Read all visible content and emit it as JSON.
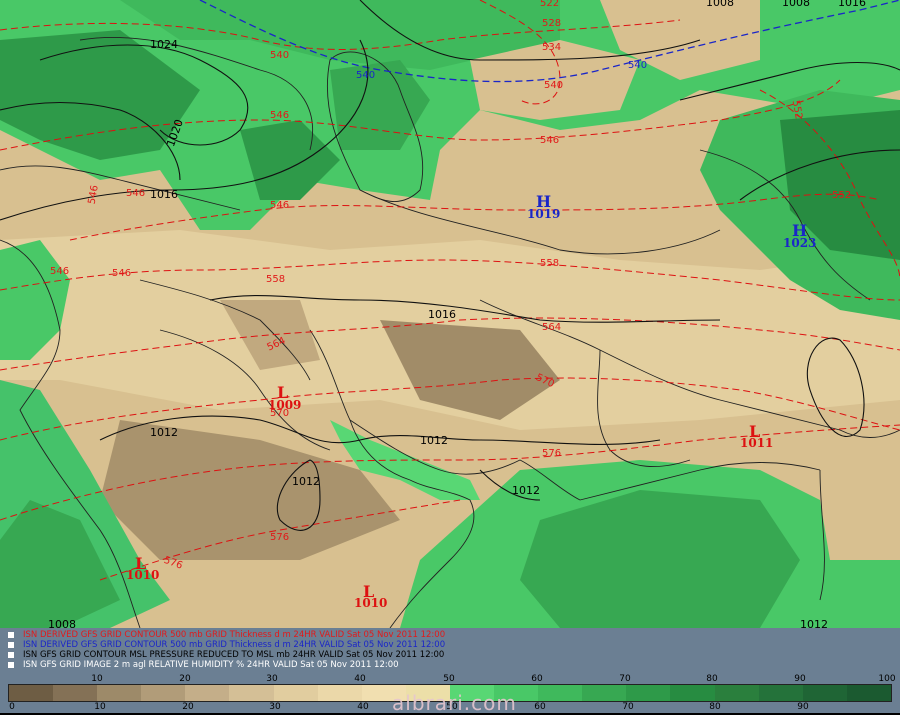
{
  "map": {
    "colors": {
      "sea": "#4fd26f",
      "land_dry": "#d8c090",
      "land_tan": "#e8d5a6",
      "land_brown": "#9f8a66",
      "humid_mid": "#45c26a",
      "humid_dark": "#2f9e52",
      "isobar": "#111111",
      "thickness": "#dd1111",
      "thickness_blue": "#1a26c8",
      "border": "#222222"
    },
    "isobar_labels": [
      {
        "id": "iso-1024",
        "text": "1024"
      },
      {
        "id": "iso-1020",
        "text": "1020"
      },
      {
        "id": "iso-1016a",
        "text": "1016"
      },
      {
        "id": "iso-1016b",
        "text": "1016"
      },
      {
        "id": "iso-1012a",
        "text": "1012"
      },
      {
        "id": "iso-1012b",
        "text": "1012"
      },
      {
        "id": "iso-1012c",
        "text": "1012"
      },
      {
        "id": "iso-1012d",
        "text": "1012"
      },
      {
        "id": "iso-1008a",
        "text": "1008"
      },
      {
        "id": "iso-1012e",
        "text": "1012"
      },
      {
        "id": "iso-1016c",
        "text": "1016"
      },
      {
        "id": "iso-1008b",
        "text": "1008"
      },
      {
        "id": "iso-1008c",
        "text": "1008"
      }
    ],
    "thickness_labels": [
      {
        "id": "th-540a",
        "text": "540"
      },
      {
        "id": "th-540b",
        "text": "540"
      },
      {
        "id": "th-540c",
        "text": "540"
      },
      {
        "id": "th-528",
        "text": "528"
      },
      {
        "id": "th-522",
        "text": "522"
      },
      {
        "id": "th-534",
        "text": "534"
      },
      {
        "id": "th-540d",
        "text": "540"
      },
      {
        "id": "th-546a",
        "text": "546"
      },
      {
        "id": "th-546b",
        "text": "546"
      },
      {
        "id": "th-546c",
        "text": "546"
      },
      {
        "id": "th-546d",
        "text": "546"
      },
      {
        "id": "th-546e",
        "text": "546"
      },
      {
        "id": "th-552a",
        "text": "552"
      },
      {
        "id": "th-552b",
        "text": "552"
      },
      {
        "id": "th-546f",
        "text": "546"
      },
      {
        "id": "th-546g",
        "text": "546"
      },
      {
        "id": "th-558a",
        "text": "558"
      },
      {
        "id": "th-558b",
        "text": "558"
      },
      {
        "id": "th-564a",
        "text": "564"
      },
      {
        "id": "th-564b",
        "text": "564"
      },
      {
        "id": "th-570a",
        "text": "570"
      },
      {
        "id": "th-570b",
        "text": "570"
      },
      {
        "id": "th-576a",
        "text": "576"
      },
      {
        "id": "th-576b",
        "text": "576"
      },
      {
        "id": "th-576c",
        "text": "576"
      }
    ],
    "pressure_centers": [
      {
        "id": "high-caspian",
        "letter": "H",
        "value": "1019",
        "color": "#1a26c8"
      },
      {
        "id": "high-east",
        "letter": "H",
        "value": "1023",
        "color": "#1a26c8"
      },
      {
        "id": "low-iraq",
        "letter": "L",
        "value": "1009",
        "color": "#dd1111"
      },
      {
        "id": "low-pakistan",
        "letter": "L",
        "value": "1011",
        "color": "#dd1111"
      },
      {
        "id": "low-redsea",
        "letter": "L",
        "value": "1010",
        "color": "#dd1111"
      },
      {
        "id": "low-yemen",
        "letter": "L",
        "value": "1010",
        "color": "#dd1111"
      }
    ]
  },
  "legend": {
    "lines": [
      {
        "text": "ISN DERIVED GFS GRID CONTOUR 500 mb GRID Thickness d m 24HR VALID Sat 05 Nov 2011 12:00",
        "color": "#e11a1a"
      },
      {
        "text": "ISN DERIVED GFS GRID CONTOUR 500 mb GRID Thickness d m 24HR VALID Sat 05 Nov 2011 12:00",
        "color": "#1a26c8"
      },
      {
        "text": "ISN GFS GRID CONTOUR MSL PRESSURE REDUCED TO MSL mb 24HR VALID Sat 05 Nov 2011 12:00",
        "color": "#000000"
      },
      {
        "text": "ISN GFS GRID IMAGE 2 m agl RELATIVE HUMIDITY % 24HR VALID Sat 05 Nov 2011 12:00",
        "color": "#ffffff"
      }
    ],
    "colorbar": [
      "#6e5d44",
      "#847156",
      "#9d8a69",
      "#b19c79",
      "#c4ae89",
      "#d4bf96",
      "#e1cd9f",
      "#ebd8a9",
      "#f1dfb0",
      "#ecdfa8",
      "#58d774",
      "#49c867",
      "#3fb95c",
      "#37a852",
      "#2e9a49",
      "#278c41",
      "#2a7f3d",
      "#24723a",
      "#1f6535",
      "#1b5a30"
    ],
    "top_ticks": [
      "10",
      "20",
      "30",
      "40",
      "50",
      "60",
      "70",
      "80",
      "90",
      "100"
    ],
    "bottom_ticks": [
      "0",
      "10",
      "20",
      "30",
      "40",
      "50",
      "60",
      "70",
      "80",
      "90"
    ],
    "watermark": "albrari.com"
  }
}
